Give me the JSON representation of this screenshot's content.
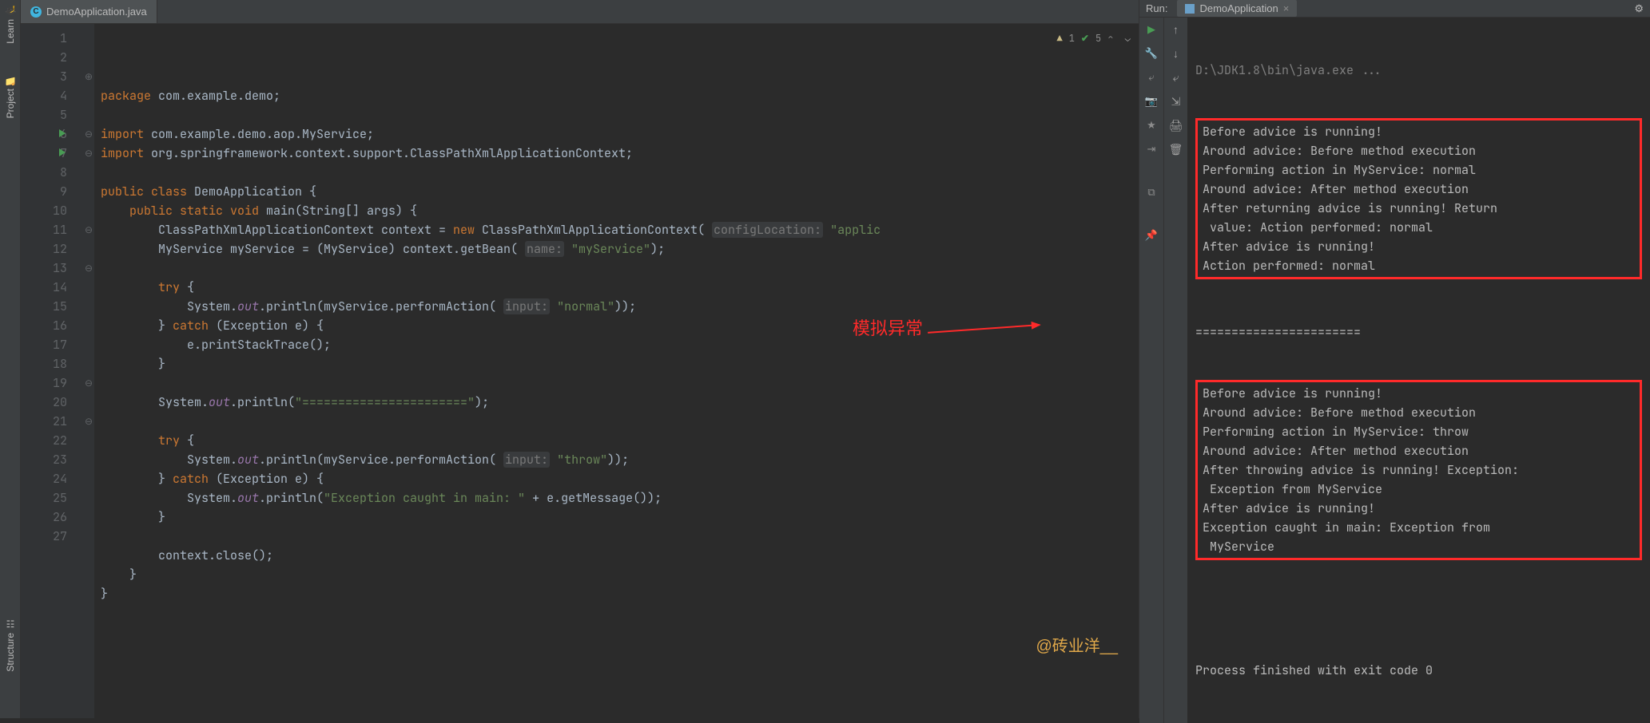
{
  "left_tabs": {
    "learn": "Learn",
    "project": "Project",
    "structure": "Structure"
  },
  "editor": {
    "file_tab": "DemoApplication.java",
    "inspection": {
      "warn_icon": "▲",
      "warn_count": "1",
      "ok_icon": "✔",
      "ok_count": "5",
      "carets": "⌃  ⌄"
    },
    "annotation": "模拟异常",
    "watermark": "@砖业洋__",
    "lines": [
      {
        "n": "1",
        "fold": "",
        "run": false,
        "html": "<span class='kw'>package</span> com.example.demo;"
      },
      {
        "n": "2",
        "fold": "",
        "run": false,
        "html": ""
      },
      {
        "n": "3",
        "fold": "⊕",
        "run": false,
        "html": "<span class='kw'>import</span> com.example.demo.aop.MyService;"
      },
      {
        "n": "4",
        "fold": "",
        "run": false,
        "html": "<span class='kw'>import</span> org.springframework.context.support.ClassPathXmlApplicationContext;"
      },
      {
        "n": "5",
        "fold": "",
        "run": false,
        "html": ""
      },
      {
        "n": "6",
        "fold": "⊖",
        "run": true,
        "html": "<span class='kw'>public class</span> DemoApplication {"
      },
      {
        "n": "7",
        "fold": "⊖",
        "run": true,
        "html": "    <span class='kw'>public static void</span> main(String[] args) {"
      },
      {
        "n": "8",
        "fold": "",
        "run": false,
        "html": "        ClassPathXmlApplicationContext context = <span class='kw'>new</span> ClassPathXmlApplicationContext( <span class='param-hint'>configLocation:</span> <span class='str'>\"applic</span>"
      },
      {
        "n": "9",
        "fold": "",
        "run": false,
        "html": "        MyService myService = (MyService) context.getBean( <span class='param-hint'>name:</span> <span class='str'>\"myService\"</span>);"
      },
      {
        "n": "10",
        "fold": "",
        "run": false,
        "html": ""
      },
      {
        "n": "11",
        "fold": "⊖",
        "run": false,
        "html": "        <span class='kw'>try</span> {"
      },
      {
        "n": "12",
        "fold": "",
        "run": false,
        "html": "            System.<span class='field'>out</span>.println(myService.performAction( <span class='param-hint'>input:</span> <span class='str'>\"normal\"</span>));"
      },
      {
        "n": "13",
        "fold": "⊖",
        "run": false,
        "html": "        } <span class='kw'>catch</span> (Exception e) {"
      },
      {
        "n": "14",
        "fold": "",
        "run": false,
        "html": "            e.printStackTrace();"
      },
      {
        "n": "15",
        "fold": "",
        "run": false,
        "html": "        }"
      },
      {
        "n": "16",
        "fold": "",
        "run": false,
        "html": ""
      },
      {
        "n": "17",
        "fold": "",
        "run": false,
        "html": "        System.<span class='field'>out</span>.println(<span class='str'>\"=======================\"</span>);"
      },
      {
        "n": "18",
        "fold": "",
        "run": false,
        "html": ""
      },
      {
        "n": "19",
        "fold": "⊖",
        "run": false,
        "html": "        <span class='kw'>try</span> {"
      },
      {
        "n": "20",
        "fold": "",
        "run": false,
        "html": "            System.<span class='field'>out</span>.println(myService.performAction( <span class='param-hint'>input:</span> <span class='str'>\"throw\"</span>));"
      },
      {
        "n": "21",
        "fold": "⊖",
        "run": false,
        "html": "        } <span class='kw'>catch</span> (Exception e) {"
      },
      {
        "n": "22",
        "fold": "",
        "run": false,
        "html": "            System.<span class='field'>out</span>.println(<span class='str'>\"Exception caught in main: \"</span> + e.getMessage());"
      },
      {
        "n": "23",
        "fold": "",
        "run": false,
        "html": "        }"
      },
      {
        "n": "24",
        "fold": "",
        "run": false,
        "html": ""
      },
      {
        "n": "25",
        "fold": "",
        "run": false,
        "html": "        context.close();"
      },
      {
        "n": "26",
        "fold": "",
        "run": false,
        "html": "    }"
      },
      {
        "n": "27",
        "fold": "",
        "run": false,
        "html": "}"
      }
    ]
  },
  "run": {
    "label": "Run:",
    "config": "DemoApplication",
    "close": "×",
    "cmd": "D:\\JDK1.8\\bin\\java.exe ...",
    "box1": [
      "Before advice is running!",
      "Around advice: Before method execution",
      "Performing action in MyService: normal",
      "Around advice: After method execution",
      "After returning advice is running! Return",
      " value: Action performed: normal",
      "After advice is running!",
      "Action performed: normal"
    ],
    "sep": "=======================",
    "box2": [
      "Before advice is running!",
      "Around advice: Before method execution",
      "Performing action in MyService: throw",
      "Around advice: After method execution",
      "After throwing advice is running! Exception:",
      " Exception from MyService",
      "After advice is running!",
      "Exception caught in main: Exception from",
      " MyService"
    ],
    "exit": "Process finished with exit code 0"
  },
  "icons": {
    "play": "▶",
    "wrench": "🔧",
    "up": "↑",
    "down": "↓",
    "wrap": "⤶",
    "export": "⇲",
    "camera": "📷",
    "print": "🖨",
    "trash": "🗑",
    "exit": "⇥",
    "layout": "⧉",
    "pin": "📌",
    "gear": "⚙"
  }
}
